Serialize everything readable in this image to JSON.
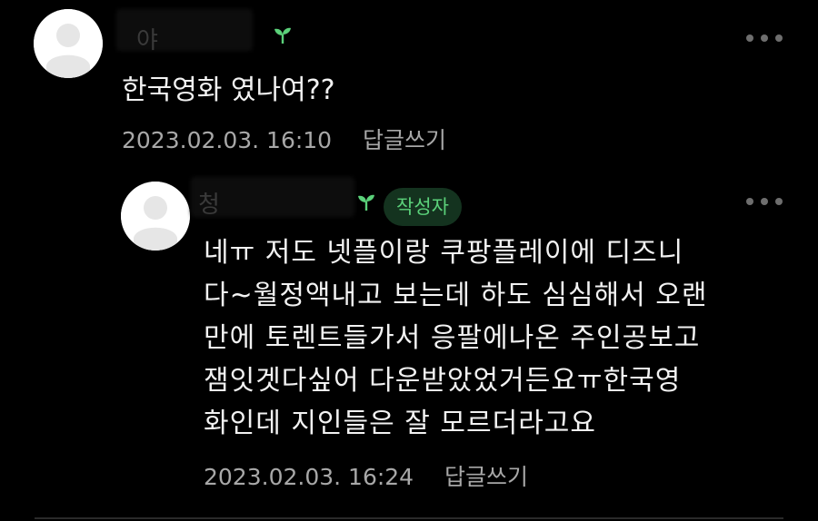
{
  "comments": [
    {
      "author_suffix": "야",
      "text": "한국영화 였나여??",
      "date": "2023.02.03. 16:10",
      "reply_label": "답글쓰기"
    },
    {
      "author_prefix": "청",
      "badge": "작성자",
      "lines": [
        "네ㅠ 저도 넷플이랑 쿠팡플레이에 디즈니",
        "다~월정액내고 보는데 하도 심심해서 오랜",
        "만에 토렌트들가서 응팔에나온 주인공보고",
        "잼잇겟다싶어 다운받았었거든요ㅠ한국영",
        "화인데 지인들은 잘 모르더라고요"
      ],
      "date": "2023.02.03. 16:24",
      "reply_label": "답글쓰기"
    }
  ],
  "colors": {
    "background": "#000000",
    "text": "#f2f2f2",
    "meta": "#a8a8a8",
    "badge_bg": "#14331f",
    "badge_text": "#5bd17a",
    "sprout": "#5bd17a"
  },
  "icons": {
    "avatar": "default-avatar-icon",
    "sprout": "sprout-icon",
    "more": "more-horizontal-icon"
  }
}
